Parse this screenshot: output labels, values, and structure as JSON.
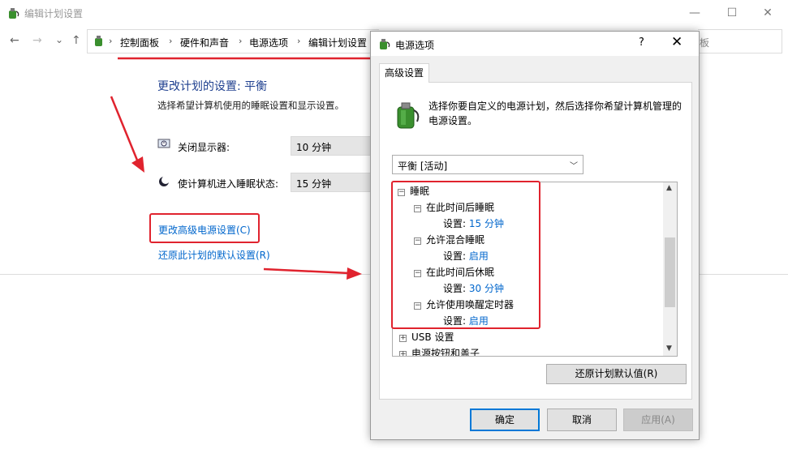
{
  "window": {
    "title": "编辑计划设置",
    "minimize": "—",
    "maximize": "☐",
    "close": "✕"
  },
  "nav": {
    "back": "←",
    "forward": "→",
    "recent": "⌄",
    "up": "↑",
    "breadcrumbs": [
      "控制面板",
      "硬件和声音",
      "电源选项",
      "编辑计划设置"
    ],
    "search_fragment": "板"
  },
  "main": {
    "heading": "更改计划的设置: 平衡",
    "description": "选择希望计算机使用的睡眠设置和显示设置。",
    "display_label": "关闭显示器:",
    "display_value": "10 分钟",
    "sleep_label": "使计算机进入睡眠状态:",
    "sleep_value": "15 分钟",
    "advanced_link": "更改高级电源设置(C)",
    "restore_link": "还原此计划的默认设置(R)"
  },
  "dialog": {
    "title": "电源选项",
    "help": "?",
    "close": "✕",
    "tab": "高级设置",
    "description": "选择你要自定义的电源计划，然后选择你希望计算机管理的电源设置。",
    "plan_select": "平衡 [活动]",
    "tree": {
      "sleep": "睡眠",
      "sleep_after": "在此时间后睡眠",
      "sleep_after_setting_label": "设置:",
      "sleep_after_value": "15 分钟",
      "hybrid": "允许混合睡眠",
      "hybrid_setting_label": "设置:",
      "hybrid_value": "启用",
      "hibernate_after": "在此时间后休眠",
      "hibernate_setting_label": "设置:",
      "hibernate_value": "30 分钟",
      "wake_timers": "允许使用唤醒定时器",
      "wake_setting_label": "设置:",
      "wake_value": "启用",
      "usb": "USB 设置",
      "power_buttons": "电源按钮和盖子"
    },
    "restore_defaults": "还原计划默认值(R)",
    "ok": "确定",
    "cancel": "取消",
    "apply": "应用(A)"
  },
  "colors": {
    "accent_red": "#e0232e",
    "link_blue": "#0066cc",
    "heading_blue": "#1e3f8f"
  }
}
